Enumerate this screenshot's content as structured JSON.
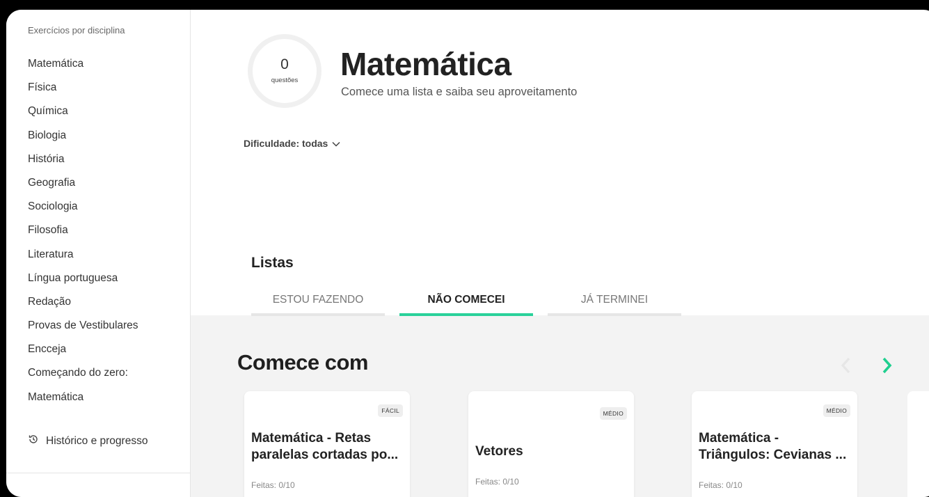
{
  "sidebar": {
    "heading": "Exercícios por disciplina",
    "items": [
      "Matemática",
      "Física",
      "Química",
      "Biologia",
      "História",
      "Geografia",
      "Sociologia",
      "Filosofia",
      "Literatura",
      "Língua portuguesa",
      "Redação",
      "Provas de Vestibulares",
      "Encceja",
      "Começando do zero:",
      "Matemática"
    ],
    "history_label": "Histórico e progresso"
  },
  "header": {
    "question_count": "0",
    "question_count_label": "questões",
    "title": "Matemática",
    "subtitle": "Comece uma lista e saiba seu aproveitamento"
  },
  "filter": {
    "difficulty_label": "Dificuldade: todas"
  },
  "lists": {
    "title": "Listas",
    "tabs": [
      "ESTOU FAZENDO",
      "NÃO COMECEI",
      "JÁ TERMINEI"
    ],
    "active_tab": "NÃO COMECEI"
  },
  "section": {
    "title": "Comece com"
  },
  "cards": [
    {
      "badge": "FÁCIL",
      "title": "Matemática - Retas paralelas cortadas po...",
      "meta": "Feitas: 0/10"
    },
    {
      "badge": "MÉDIO",
      "title": "Vetores",
      "meta": "Feitas: 0/10"
    },
    {
      "badge": "MÉDIO",
      "title": "Matemática - Triângulos: Cevianas ...",
      "meta": "Feitas: 0/10"
    }
  ],
  "colors": {
    "accent": "#2ad19a",
    "gray_bg": "#f3f3f3"
  }
}
